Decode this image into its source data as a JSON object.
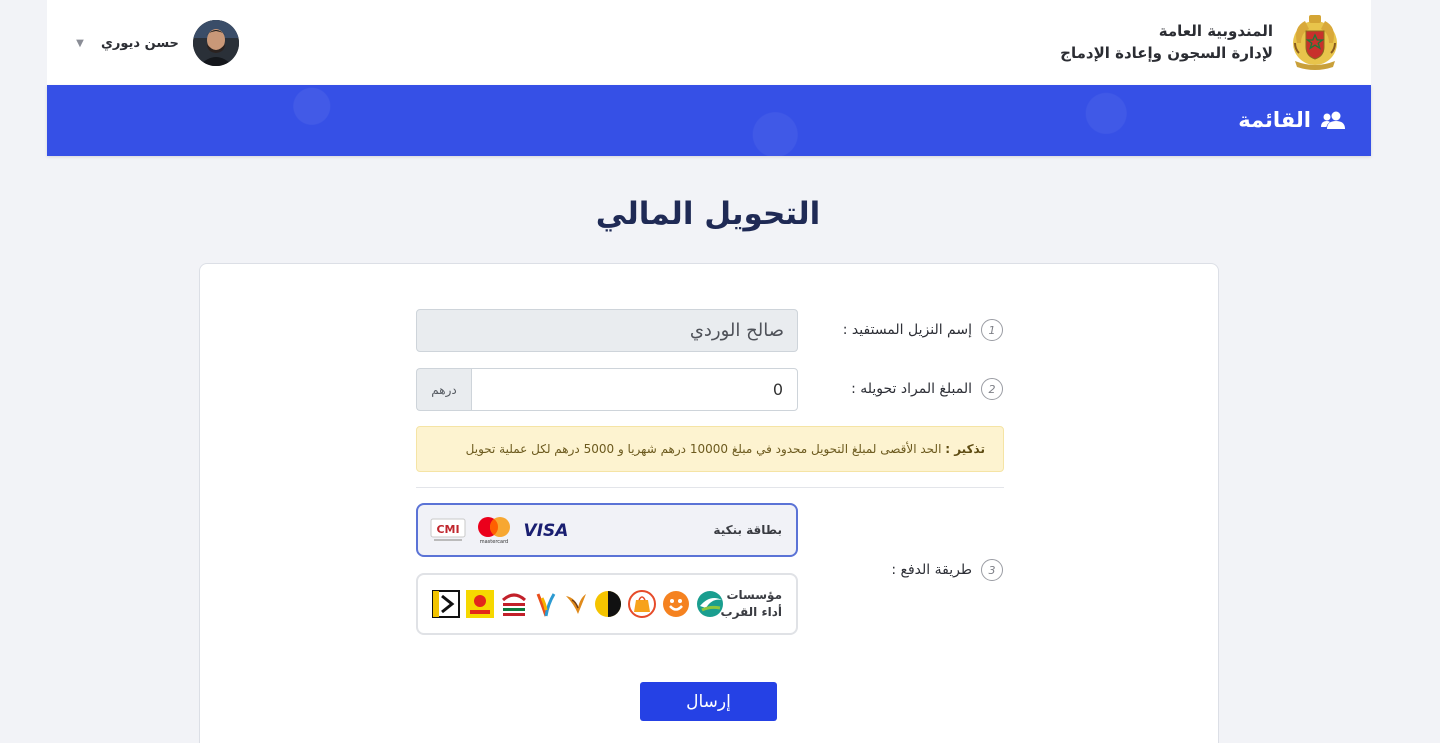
{
  "header": {
    "org_line1": "المندوبية العامة",
    "org_line2": "لإدارة السجون وإعادة الإدماج",
    "user_name": "حسن ديوري"
  },
  "nav": {
    "menu_label": "القائمة"
  },
  "page": {
    "title": "التحويل المالي"
  },
  "form": {
    "step1": "1",
    "step2": "2",
    "step3": "3",
    "beneficiary_label": "إسم النزيل المستفيد :",
    "beneficiary_value": "صالح الوردي",
    "amount_label": "المبلغ المراد تحويله :",
    "amount_value": "0",
    "currency": "درهم",
    "reminder_title": "تذكير :",
    "reminder_text": " الحد الأقصى لمبلغ التحويل محدود في مبلغ 10000 درهم شهريا و 5000 درهم لكل عملية تحويل",
    "payment_label": "طريقة الدفع :",
    "bank_card_label": "بطاقة بنكية",
    "agents_label_line1": "مؤسسات",
    "agents_label_line2": "أداء القرب",
    "submit_label": "إرسال"
  },
  "logos": {
    "visa": "VISA",
    "cmi": "CMI",
    "mastercard": "mastercard"
  },
  "colors": {
    "banner": "#3650e6",
    "submit": "#2541e5",
    "title": "#1f2a55",
    "alert_bg": "#fdf3d0"
  }
}
